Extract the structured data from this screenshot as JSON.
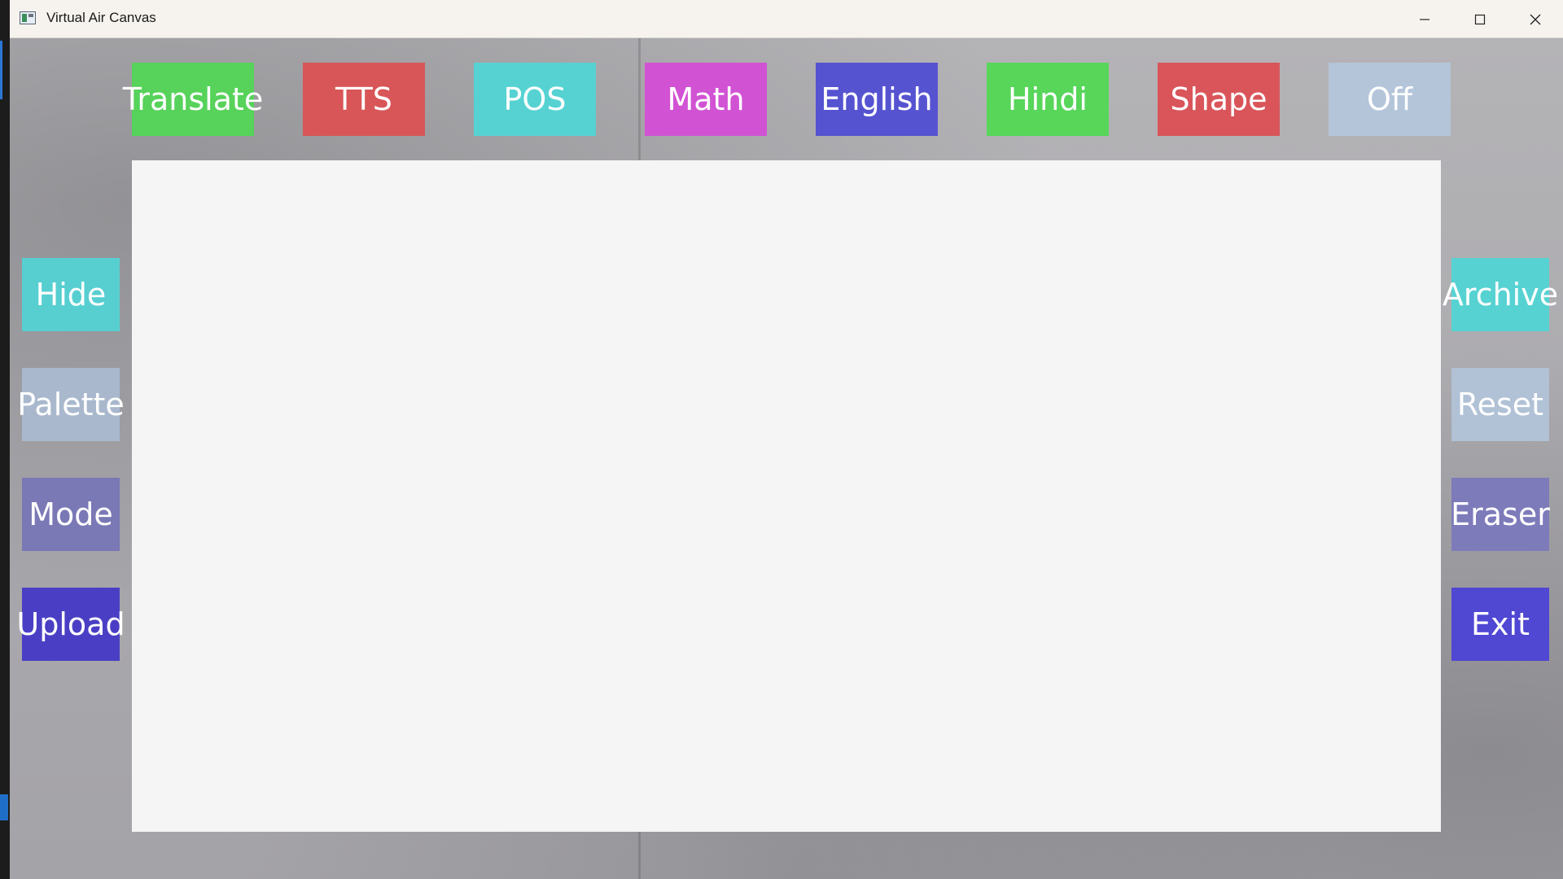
{
  "window": {
    "title": "Virtual Air Canvas"
  },
  "top_buttons": [
    {
      "label": "Translate",
      "color": "#57d25a"
    },
    {
      "label": "TTS",
      "color": "#d85658"
    },
    {
      "label": "POS",
      "color": "#56d2d2"
    },
    {
      "label": "Math",
      "color": "#d153d3"
    },
    {
      "label": "English",
      "color": "#5653d1"
    },
    {
      "label": "Hindi",
      "color": "#57d65a"
    },
    {
      "label": "Shape",
      "color": "#d9555a"
    },
    {
      "label": "Off",
      "color": "#b4c5da"
    }
  ],
  "left_buttons": [
    {
      "label": "Hide",
      "color": "#57cfd1"
    },
    {
      "label": "Palette",
      "color": "#a9b8cd"
    },
    {
      "label": "Mode",
      "color": "#7a78b5"
    },
    {
      "label": "Upload",
      "color": "#4a3fc4"
    }
  ],
  "right_buttons": [
    {
      "label": "Archive",
      "color": "#57d2d2"
    },
    {
      "label": "Reset",
      "color": "#b1c1d6"
    },
    {
      "label": "Eraser",
      "color": "#7d7bba"
    },
    {
      "label": "Exit",
      "color": "#5047d3"
    }
  ]
}
